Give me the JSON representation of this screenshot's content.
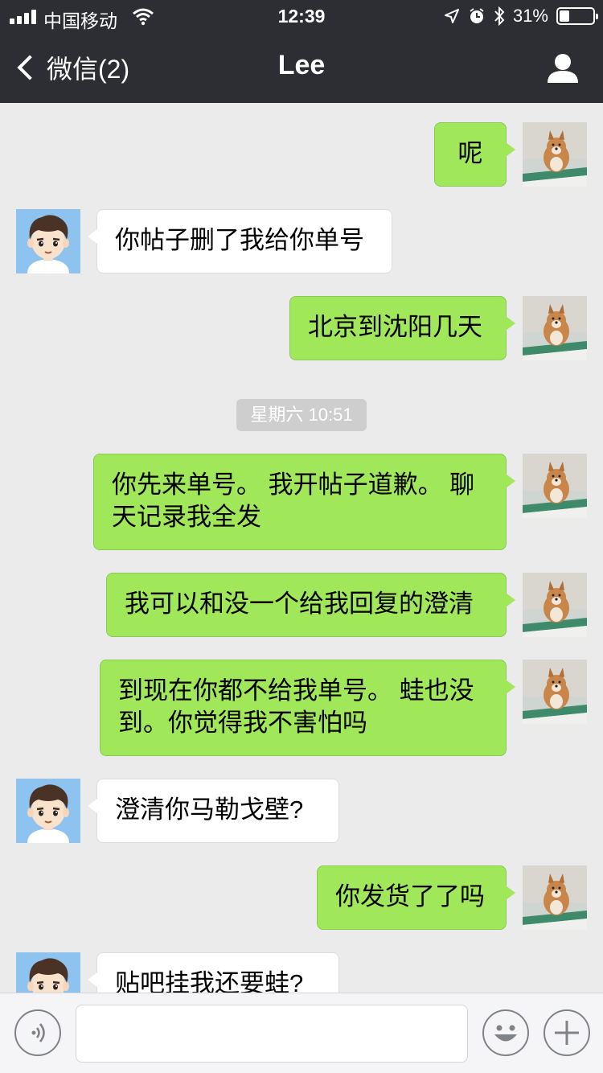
{
  "status_bar": {
    "carrier": "中国移动",
    "time": "12:39",
    "battery": "31%",
    "battery_level": 0.31,
    "icons": [
      "signal-icon",
      "wifi-icon",
      "location-icon",
      "alarm-icon",
      "bluetooth-icon",
      "battery-icon"
    ]
  },
  "nav": {
    "back_label": "微信(2)",
    "title": "Lee",
    "profile_icon": "person-icon"
  },
  "messages": [
    {
      "from": "me",
      "text": "呢"
    },
    {
      "from": "them",
      "text": "你帖子删了我给你单号"
    },
    {
      "from": "me",
      "text": "北京到沈阳几天"
    },
    {
      "type": "timestamp",
      "text": "星期六 10:51"
    },
    {
      "from": "me",
      "text": "你先来单号。 我开帖子道歉。 聊天记录我全发"
    },
    {
      "from": "me",
      "text": "我可以和没一个给我回复的澄清"
    },
    {
      "from": "me",
      "text": "到现在你都不给我单号。 蛙也没到。你觉得我不害怕吗"
    },
    {
      "from": "them",
      "text": "澄清你马勒戈壁?"
    },
    {
      "from": "me",
      "text": "你发货了了吗"
    },
    {
      "from": "them",
      "text": "贴吧挂我还要蛙?"
    }
  ],
  "input_bar": {
    "voice_icon": "voice-icon",
    "text_value": "",
    "emoji_icon": "emoji-icon",
    "more_icon": "plus-icon"
  }
}
